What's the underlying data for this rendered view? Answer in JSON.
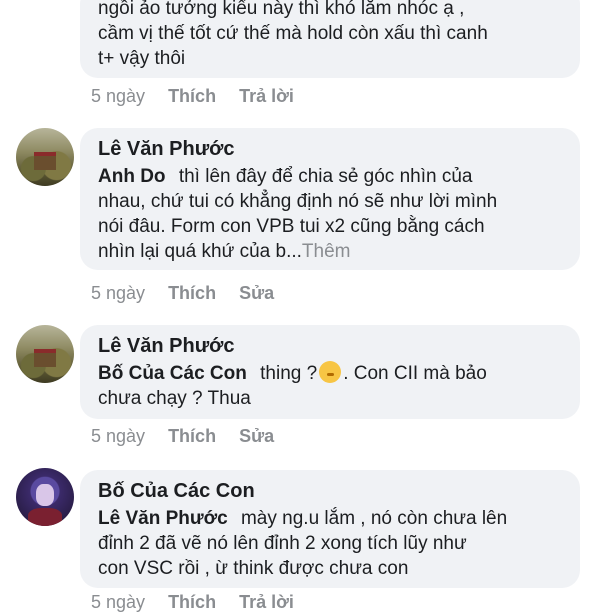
{
  "comments": [
    {
      "lines": [
        "ngồi ảo tưởng kiểu này thì khó lắm nhóc ạ ,",
        "cầm vị thế tốt cứ thế mà hold còn xấu thì canh",
        "t+ vậy thôi"
      ],
      "time": "5 ngày",
      "action1": "Thích",
      "action2": "Trả lời"
    },
    {
      "author": "Lê Văn Phước",
      "mention": "Anh Do",
      "lines": [
        "thì lên đây để chia sẻ góc nhìn của",
        "nhau, chứ tui có khẳng định nó sẽ như lời mình",
        "nói đâu. Form con VPB tui x2 cũng bằng cách",
        "nhìn lại quá khứ của b..."
      ],
      "more": "Thêm",
      "time": "5 ngày",
      "action1": "Thích",
      "action2": "Sửa"
    },
    {
      "author": "Lê Văn Phước",
      "mention": "Bố Của Các Con",
      "lines": [
        "thing ?",
        ". Con CII mà bảo",
        "chưa chạy ? Thua"
      ],
      "emoji": "shushing-face-emoji",
      "time": "5 ngày",
      "action1": "Thích",
      "action2": "Sửa"
    },
    {
      "author": "Bố Của Các Con",
      "mention": "Lê Văn Phước",
      "lines": [
        "mày ng.u lắm , nó còn chưa lên",
        "đỉnh 2 đã vẽ nó lên đỉnh 2 xong tích lũy như",
        "con VSC rồi , ừ think được chưa con"
      ],
      "time": "5 ngày",
      "action1": "Thích",
      "action2": "Trả lời"
    }
  ]
}
